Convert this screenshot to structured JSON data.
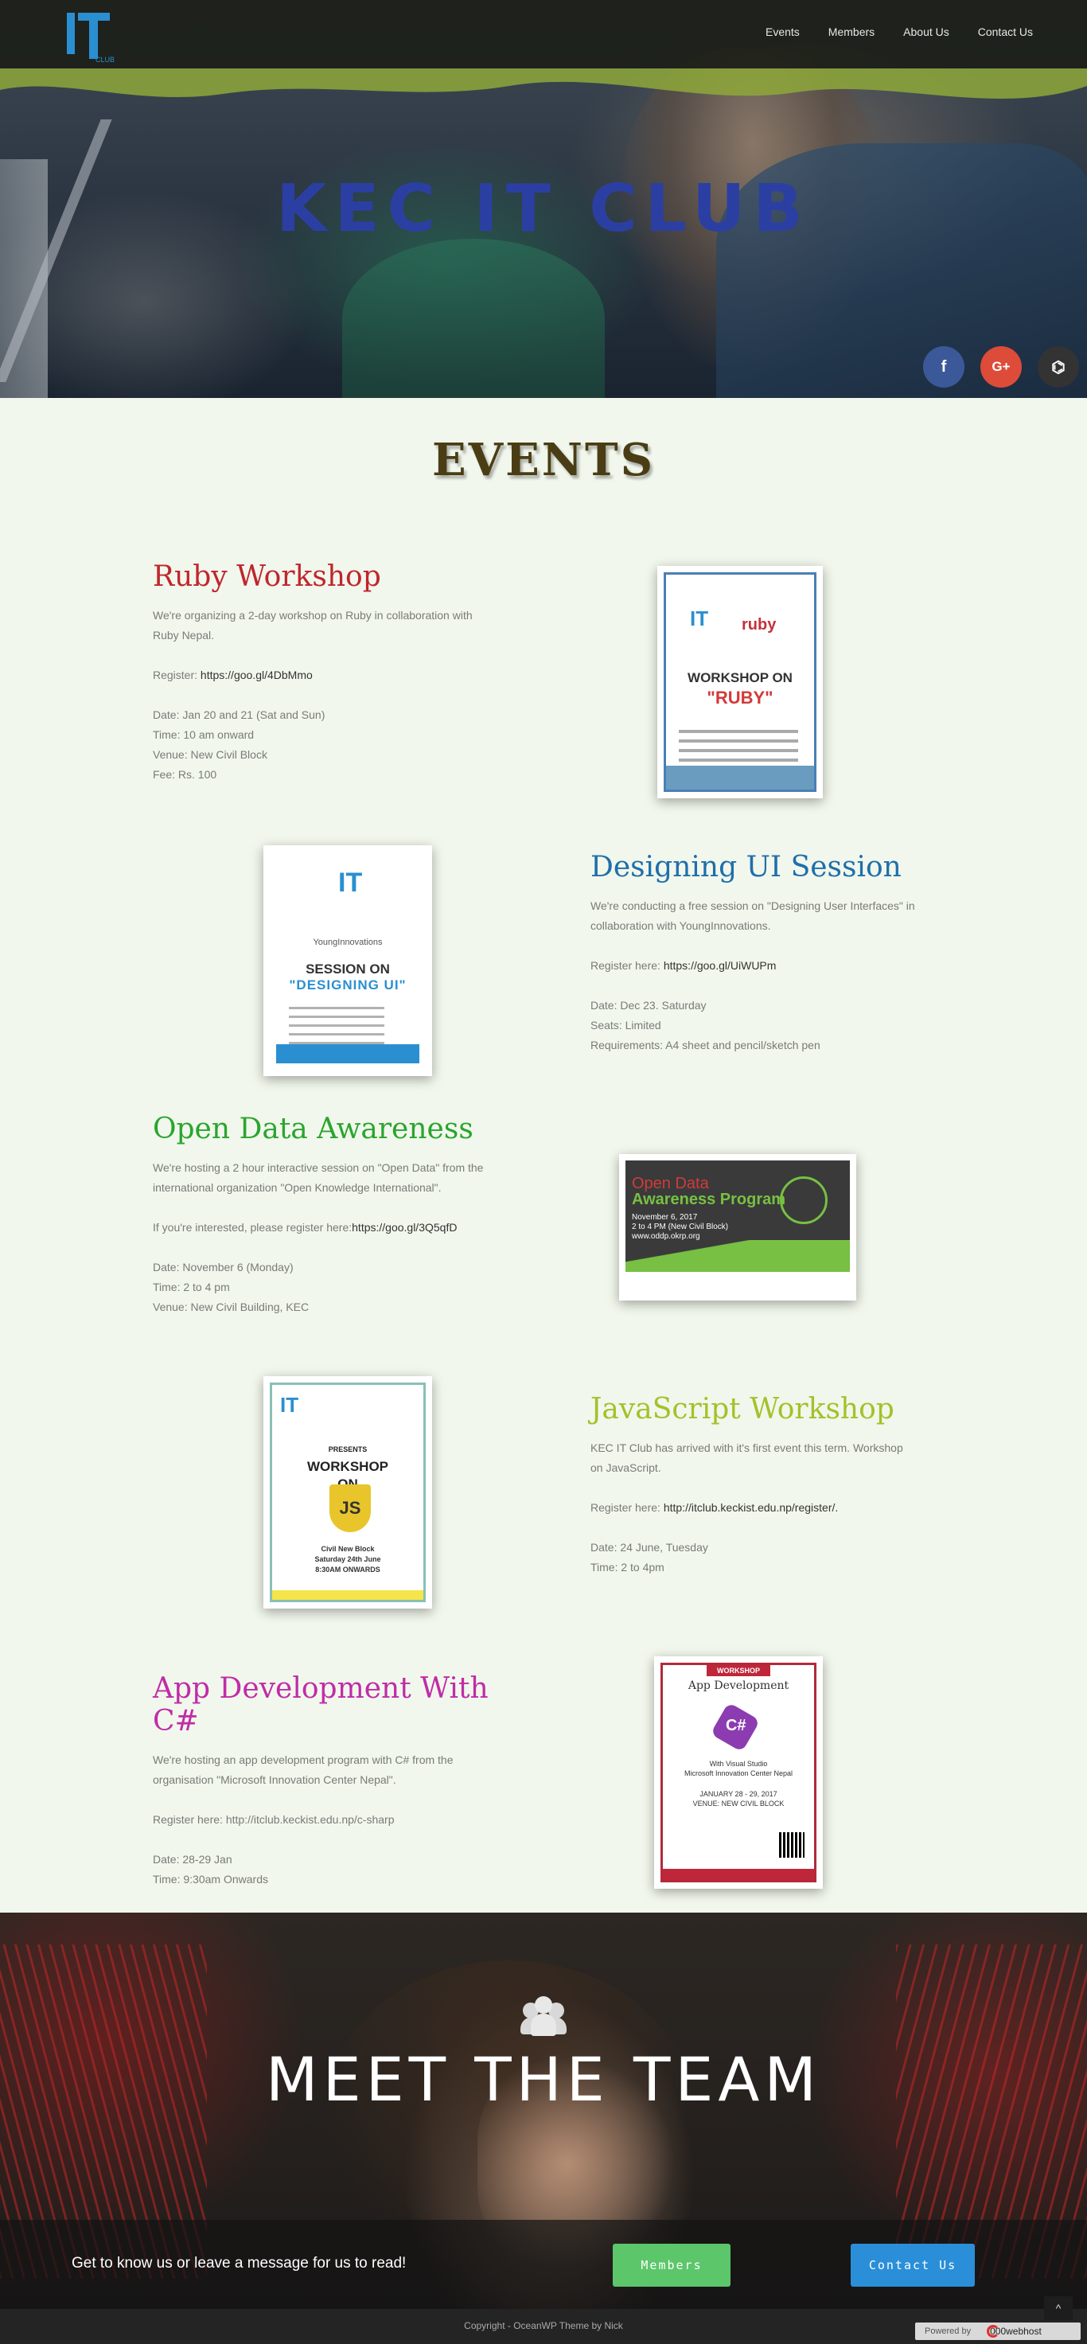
{
  "site": {
    "title": "KEC IT CLUB",
    "logo_text": "CLUB"
  },
  "nav": {
    "items": [
      {
        "label": "Events"
      },
      {
        "label": "Members"
      },
      {
        "label": "About Us"
      },
      {
        "label": "Contact Us"
      }
    ]
  },
  "social": [
    {
      "name": "facebook-icon",
      "glyph": "f"
    },
    {
      "name": "google-plus-icon",
      "glyph": "G+"
    },
    {
      "name": "github-icon",
      "glyph": "⌬"
    }
  ],
  "events": {
    "heading": "EVENTS",
    "items": [
      {
        "title": "Ruby Workshop",
        "color": "#c0262d",
        "desc": "We're organizing a 2-day workshop on Ruby in collaboration with Ruby Nepal.",
        "register_label": "Register: ",
        "register_link": "https://goo.gl/4DbMmo",
        "details": [
          "Date: Jan 20 and 21 (Sat and Sun)",
          "Time: 10 am onward",
          "Venue: New Civil Block",
          "Fee: Rs. 100"
        ],
        "poster": {
          "it": "IT",
          "partner": "ruby",
          "line1": "WORKSHOP ON",
          "line2": "\"RUBY\""
        }
      },
      {
        "title": "Designing UI Session",
        "color": "#1f6fab",
        "desc": "We're conducting a free session on \"Designing User Interfaces\" in collaboration with YoungInnovations.",
        "register_label": "Register here: ",
        "register_link": "https://goo.gl/UiWUPm",
        "details": [
          "Date: Dec 23. Saturday",
          "Seats: Limited",
          "Requirements: A4 sheet and pencil/sketch pen"
        ],
        "poster": {
          "it": "IT",
          "partner": "YoungInnovations",
          "line1": "SESSION ON",
          "line2": "\"DESIGNING UI\""
        }
      },
      {
        "title": "Open Data Awareness",
        "color": "#2aa52e",
        "desc": "We're hosting a 2 hour interactive session on \"Open Data\" from the international organization \"Open Knowledge International\".",
        "register_label": "If you're interested, please register here:",
        "register_link": "https://goo.gl/3Q5qfD",
        "details": [
          "Date: November 6 (Monday)",
          "Time: 2 to 4 pm",
          "Venue: New Civil Building, KEC"
        ],
        "poster": {
          "line1": "Open Data",
          "line2": "Awareness Program",
          "line3": "November 6, 2017",
          "line4": "2 to 4 PM (New Civil Block)",
          "line5": "www.oddp.okrp.org"
        }
      },
      {
        "title": "JavaScript Workshop",
        "color": "#a4c12a",
        "desc": "KEC IT Club has arrived with it's first event this term. Workshop on JavaScript.",
        "register_label": "Register here: ",
        "register_link": "http://itclub.keckist.edu.np/register/.",
        "details": [
          "Date: 24 June, Tuesday",
          "Time: 2 to 4pm"
        ],
        "poster": {
          "it": "IT",
          "line1": "PRESENTS",
          "line2": "WORKSHOP",
          "line3": "ON",
          "badge": "JS",
          "loc1": "Civil New Block",
          "loc2": "Saturday 24th June",
          "loc3": "8:30AM ONWARDS"
        }
      },
      {
        "title": "App Development With C#",
        "color": "#c02ca8",
        "desc": "We're hosting an app development program with C# from the organisation \"Microsoft Innovation Center Nepal\".",
        "register_label": "Register here: ",
        "register_link": "http://itclub.keckist.edu.np/c-sharp",
        "link_plain": true,
        "details": [
          "Date: 28-29 Jan",
          "Time: 9:30am Onwards"
        ],
        "poster": {
          "workshop": "WORKSHOP",
          "line1": "App Development",
          "badge": "C#",
          "with": "With Visual Studio",
          "ms": "Microsoft Innovation Center Nepal",
          "date": "JANUARY 28 - 29, 2017",
          "venue": "VENUE: NEW CIVIL BLOCK"
        }
      }
    ]
  },
  "team": {
    "title": "MEET THE TEAM"
  },
  "cta": {
    "message": "Get to know us or leave a message for us to read!",
    "members_label": "Members",
    "contact_label": "Contact Us"
  },
  "footer": {
    "copyright": "Copyright - OceanWP Theme by Nick",
    "powered_label": "Powered by",
    "host": "000webhost",
    "up_glyph": "^"
  }
}
